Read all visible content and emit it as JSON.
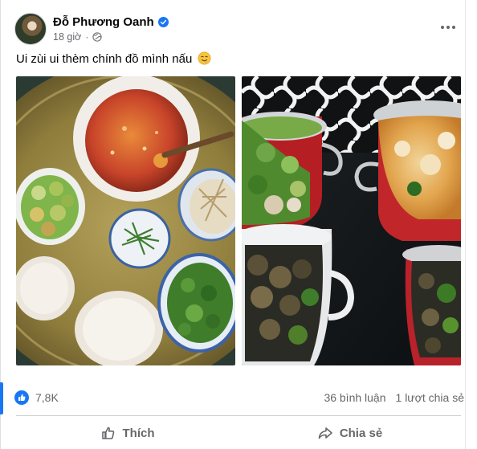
{
  "post": {
    "author_name": "Đỗ Phương Oanh",
    "time": "18 giờ",
    "separator": "·",
    "text": "Ui zùi ui thèm chính đồ mình nấu",
    "emoji": "drooling-face-icon",
    "privacy_icon": "globe-icon",
    "verified_icon": "verified-badge-icon"
  },
  "stats": {
    "reactions": "7,8K",
    "comments": "36 bình luận",
    "shares": "1 lượt chia sẻ"
  },
  "actions": {
    "like_label": "Thích",
    "share_label": "Chia sẻ"
  },
  "colors": {
    "brand_blue": "#1877f2",
    "secondary_text": "#65676b",
    "divider": "#ced0d4"
  }
}
